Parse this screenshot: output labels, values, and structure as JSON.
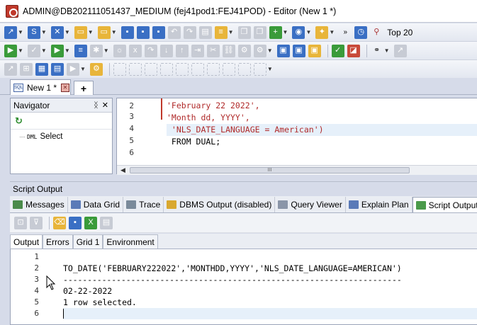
{
  "window": {
    "title": "ADMIN@DB202111051437_MEDIUM (fej41pod1:FEJ41POD) - Editor (New 1 *)"
  },
  "toolbar": {
    "top_label": "Top 20"
  },
  "tabs": {
    "doc_tab_label": "New 1 *",
    "add_tab_label": "+"
  },
  "navigator": {
    "title": "Navigator",
    "item_label": "Select",
    "item_prefix": "DML"
  },
  "editor": {
    "line_numbers": [
      "2",
      "3",
      "4",
      "5",
      "6"
    ],
    "lines": [
      "'February 22 2022',",
      "'Month dd, YYYY',",
      " 'NLS_DATE_LANGUAGE = American')",
      " FROM DUAL;",
      ""
    ],
    "scroll_thumb_label": "III"
  },
  "script_output": {
    "panel_title": "Script Output",
    "tabs": [
      "Messages",
      "Data Grid",
      "Trace",
      "DBMS Output (disabled)",
      "Query Viewer",
      "Explain Plan",
      "Script Output"
    ],
    "sub_tabs": [
      "Output",
      "Errors",
      "Grid 1",
      "Environment"
    ],
    "line_numbers": [
      "1",
      "2",
      "3",
      "4",
      "5",
      "6"
    ],
    "lines": [
      "",
      "TO_DATE('FEBRUARY222022','MONTHDD,YYYY','NLS_DATE_LANGUAGE=AMERICAN')",
      "----------------------------------------------------------------------",
      "02-22-2022",
      "1 row selected.",
      ""
    ]
  },
  "colors": {
    "string_literal": "#b02a2a",
    "current_line_highlight": "#e6f0fa",
    "panel_background": "#d6dbe9"
  }
}
